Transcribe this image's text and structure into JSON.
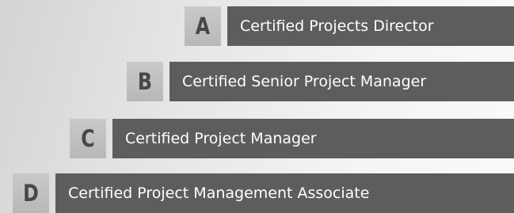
{
  "levels": [
    {
      "letter": "A",
      "label": "Certified Projects Director"
    },
    {
      "letter": "B",
      "label": "Certified Senior Project Manager"
    },
    {
      "letter": "C",
      "label": "Certified Project Manager"
    },
    {
      "letter": "D",
      "label": "Certified Project Management Associate"
    }
  ],
  "colors": {
    "bar": "#5d5d5d",
    "letter_box": "#bdbdbd",
    "letter_text": "#474747",
    "bar_text": "#ffffff"
  }
}
